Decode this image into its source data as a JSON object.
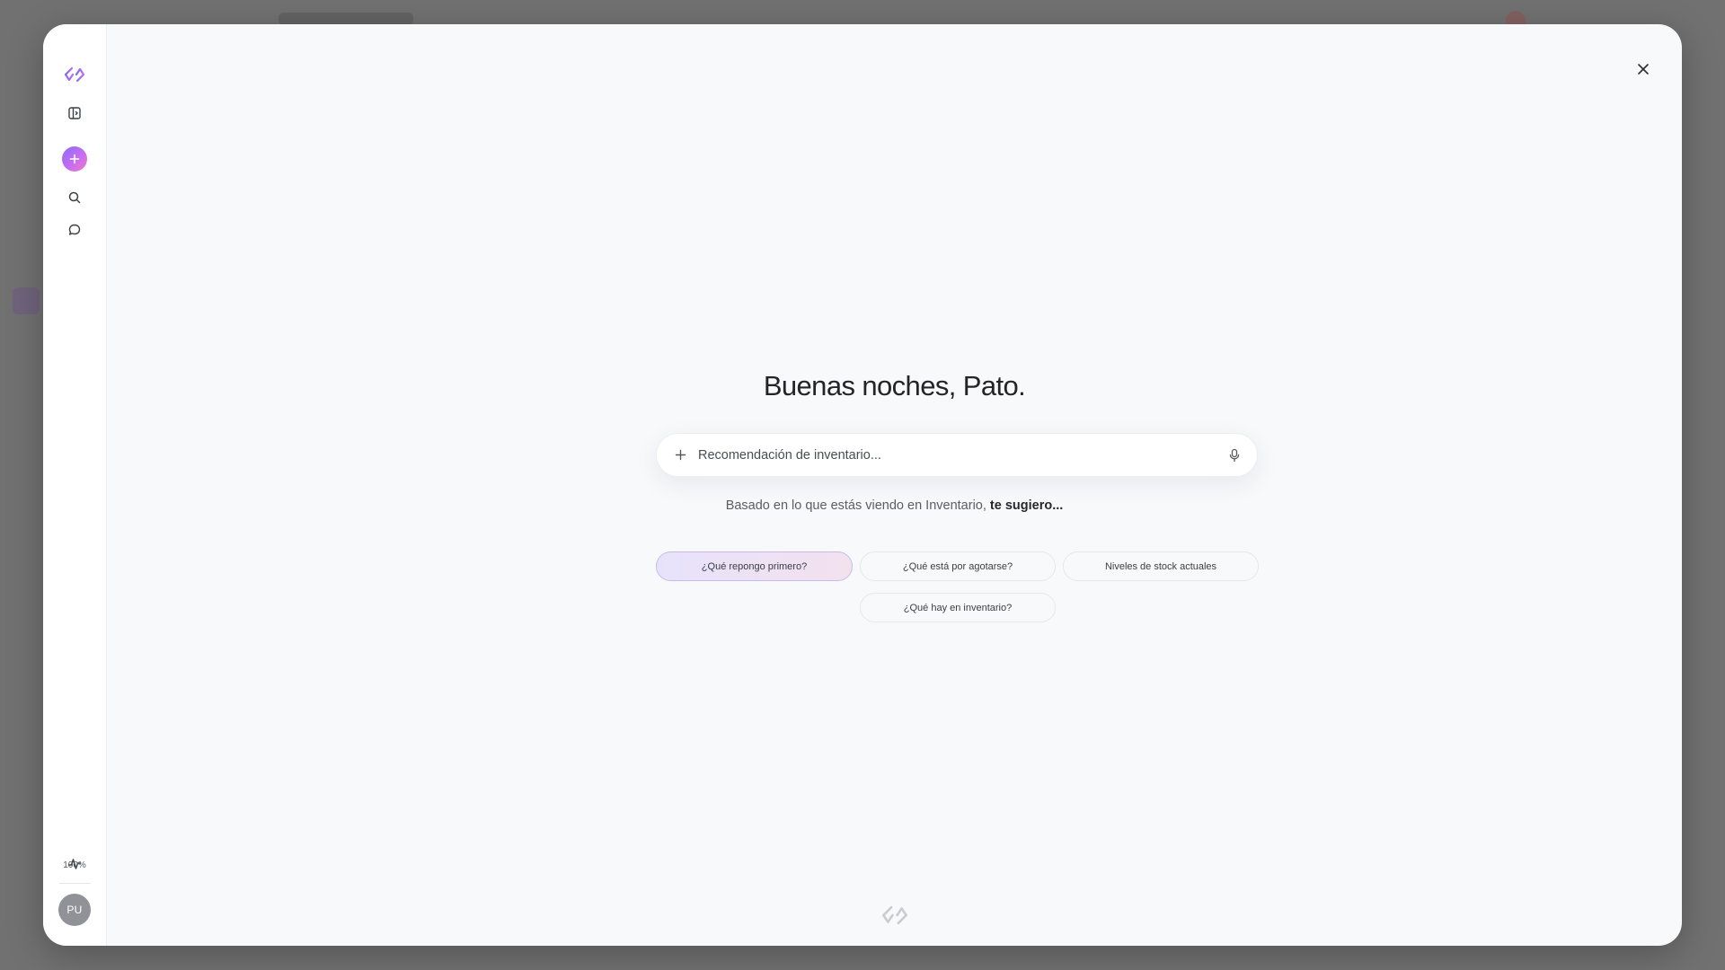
{
  "colors": {
    "accent_start": "#8a6cf7",
    "accent_end": "#f27ac4",
    "modal_bg": "#f8f9fb",
    "text_primary": "#222428"
  },
  "sidebar": {
    "logo_icon": "brand-logo-icon",
    "items": [
      {
        "icon": "sidebar-toggle-icon"
      },
      {
        "icon": "plus-icon",
        "role": "new-chat"
      },
      {
        "icon": "search-icon"
      },
      {
        "icon": "chat-bubble-icon"
      }
    ],
    "activity_icon": "activity-icon",
    "zoom_label": "100%",
    "avatar_initials": "PU"
  },
  "main": {
    "greeting": "Buenas noches, Pato.",
    "composer": {
      "placeholder": "Recomendación de inventario..."
    },
    "suggest_prefix": "Basado en lo que estás viendo en Inventario, ",
    "suggest_bold": "te sugiero...",
    "chips": [
      {
        "label": "¿Qué repongo primero?",
        "active": true
      },
      {
        "label": "¿Qué está por agotarse?",
        "active": false
      },
      {
        "label": "Niveles de stock actuales",
        "active": false
      },
      {
        "label": "¿Qué hay en inventario?",
        "active": false
      }
    ]
  }
}
